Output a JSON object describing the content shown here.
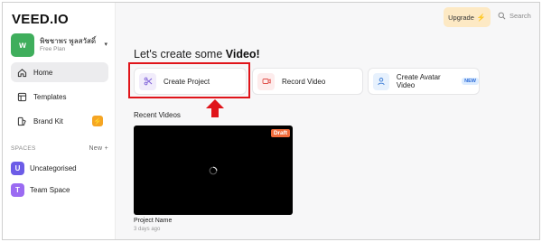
{
  "brand": {
    "logo": "VEED.IO"
  },
  "workspace": {
    "avatar_letter": "w",
    "name": "พิชชาพร พูลสวัสดิ์",
    "plan": "Free Plan",
    "avatar_color": "#3fae5c"
  },
  "sidebar": {
    "items": [
      {
        "label": "Home",
        "icon": "home-icon",
        "active": true
      },
      {
        "label": "Templates",
        "icon": "templates-icon"
      },
      {
        "label": "Brand Kit",
        "icon": "brand-kit-icon",
        "badge_icon": "bolt-icon"
      }
    ],
    "spaces_heading": "SPACES",
    "spaces_new": "New +",
    "spaces": [
      {
        "letter": "U",
        "label": "Uncategorised",
        "color": "#6c5ce7"
      },
      {
        "letter": "T",
        "label": "Team Space",
        "color": "#9b6bf2"
      }
    ]
  },
  "topbar": {
    "upgrade_label": "Upgrade",
    "search_label": "Search"
  },
  "main": {
    "heading_prefix": "Let's create some ",
    "heading_bold": "Video!",
    "actions": [
      {
        "label": "Create Project",
        "icon": "scissors-icon",
        "icon_bg": "#f1ecfb",
        "icon_color": "#7a5ad8"
      },
      {
        "label": "Record Video",
        "icon": "record-icon",
        "icon_bg": "#fdecec",
        "icon_color": "#e0504a"
      },
      {
        "label": "Create Avatar Video",
        "icon": "avatar-icon",
        "icon_bg": "#e7f1fd",
        "icon_color": "#3a7bd5",
        "badge": "NEW"
      }
    ],
    "recent_title": "Recent Videos",
    "videos": [
      {
        "title": "Project Name",
        "time": "3 days ago",
        "badge": "Draft"
      }
    ]
  },
  "annotation": {
    "highlight_color": "#e0141a"
  }
}
